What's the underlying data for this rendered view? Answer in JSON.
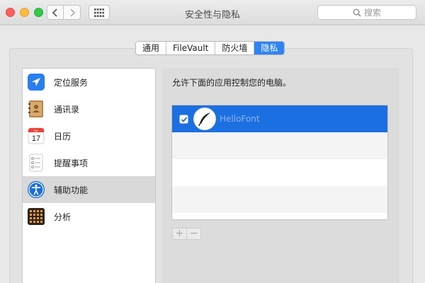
{
  "window": {
    "title": "安全性与隐私",
    "traffic_lights": [
      "close",
      "minimize",
      "zoom"
    ]
  },
  "toolbar": {
    "back_icon": "chevron-left-icon",
    "forward_icon": "chevron-right-icon",
    "show_all_icon": "grid-icon"
  },
  "search": {
    "placeholder": "搜索",
    "icon": "magnifier-icon"
  },
  "tabs": [
    {
      "label": "通用",
      "active": false
    },
    {
      "label": "FileVault",
      "active": false
    },
    {
      "label": "防火墙",
      "active": false
    },
    {
      "label": "隐私",
      "active": true
    }
  ],
  "sidebar": {
    "items": [
      {
        "label": "定位服务",
        "icon": "location-arrow-icon",
        "selected": false
      },
      {
        "label": "通讯录",
        "icon": "contacts-book-icon",
        "selected": false
      },
      {
        "label": "日历",
        "icon": "calendar-icon",
        "calendar_day": "17",
        "calendar_month": "JUL",
        "selected": false
      },
      {
        "label": "提醒事项",
        "icon": "reminders-icon",
        "selected": false
      },
      {
        "label": "辅助功能",
        "icon": "accessibility-icon",
        "selected": true
      },
      {
        "label": "分析",
        "icon": "analytics-grid-icon",
        "selected": false
      }
    ]
  },
  "privacy": {
    "prompt": "允许下面的应用控制您的电脑。",
    "apps": [
      {
        "name": "HelloFont",
        "checked": true,
        "icon": "quill-icon"
      }
    ],
    "add_label": "+",
    "remove_label": "−"
  },
  "colors": {
    "accent": "#2f83f2",
    "selected_row": "#1b6fe0",
    "sidebar_selected": "#d9d9d9"
  }
}
